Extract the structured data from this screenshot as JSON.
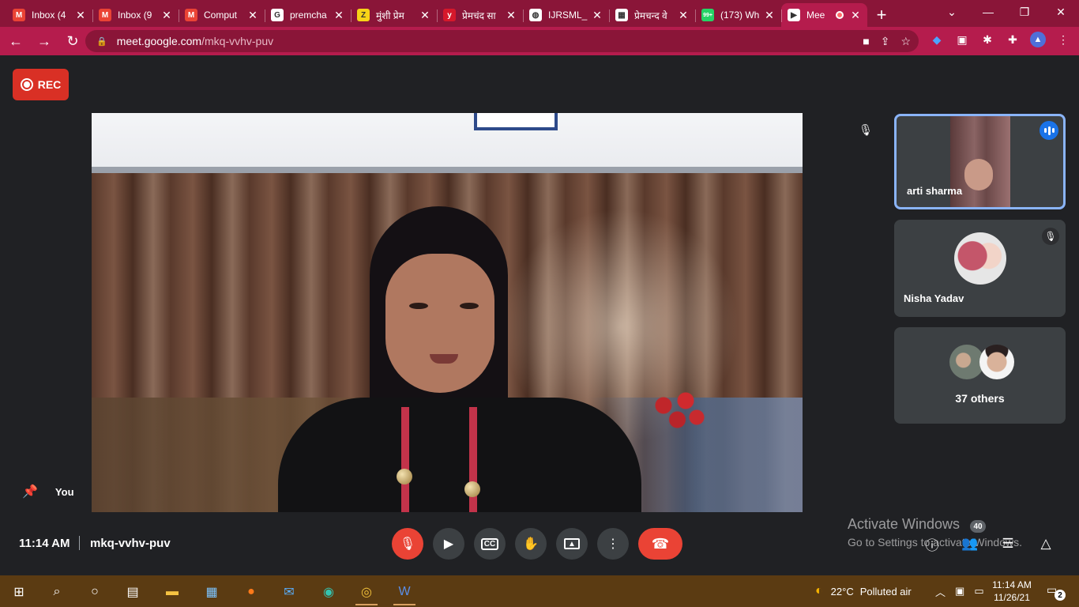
{
  "browser": {
    "tabs": [
      {
        "title": "Inbox (4",
        "favicon": "gmail-icon",
        "color": "#ea4335",
        "glyph": "M"
      },
      {
        "title": "Inbox (9",
        "favicon": "gmail-icon",
        "color": "#ea4335",
        "glyph": "M"
      },
      {
        "title": "Comput",
        "favicon": "gmail-icon",
        "color": "#ea4335",
        "glyph": "M"
      },
      {
        "title": "premcha",
        "favicon": "google-icon",
        "color": "#ffffff",
        "glyph": "G"
      },
      {
        "title": "मुंशी प्रेम",
        "favicon": "z-icon",
        "color": "#f7d417",
        "glyph": "Z"
      },
      {
        "title": "प्रेमचंद सा",
        "favicon": "y-icon",
        "color": "#d6182b",
        "glyph": "y"
      },
      {
        "title": "IJRSML_",
        "favicon": "globe-icon",
        "color": "#ffffff",
        "glyph": "◍"
      },
      {
        "title": "प्रेमचन्द वे",
        "favicon": "site-icon",
        "color": "#ffffff",
        "glyph": "▦"
      },
      {
        "title": "(173) Wh",
        "favicon": "whatsapp-icon",
        "color": "#25d366",
        "glyph": "99+"
      },
      {
        "title": "Mee",
        "favicon": "meet-icon",
        "color": "#ffffff",
        "glyph": "▶",
        "active": true
      }
    ],
    "url_host": "meet.google.com",
    "url_path": "/mkq-vvhv-puv"
  },
  "meet": {
    "rec_label": "REC",
    "participants": {
      "speaker_name": "arti sharma",
      "second_name": "Nisha Yadav",
      "others_label": "37 others"
    },
    "self_label": "You",
    "time": "11:14 AM",
    "meeting_code": "mkq-vvhv-puv",
    "people_count": "40",
    "watermark_title": "Activate Windows",
    "watermark_sub": "Go to Settings to activate Windows."
  },
  "taskbar": {
    "weather": "22°C",
    "air": "Polluted air",
    "time": "11:14 AM",
    "date": "11/26/21",
    "notifications": "2"
  },
  "colors": {
    "tabbar": "#8a1538",
    "toolbar": "#b51c4d",
    "meet_bg": "#202124",
    "tile_bg": "#3c4043",
    "end_call": "#ea4335",
    "speaking_blue": "#1a73e8",
    "taskbar": "#5b3b12"
  }
}
